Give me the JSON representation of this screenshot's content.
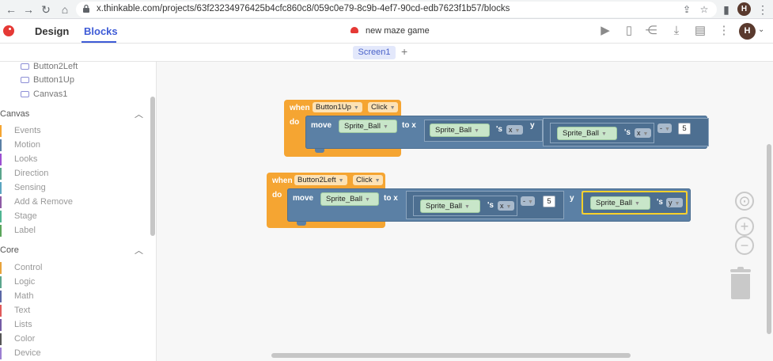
{
  "browser": {
    "url": "x.thinkable.com/projects/63f23234976425b4cfc860c8/059c0e79-8c9b-4ef7-90cd-edb7623f1b57/blocks",
    "profile_initial": "H"
  },
  "app": {
    "tabs": {
      "design": "Design",
      "blocks": "Blocks"
    },
    "project_title": "new maze game",
    "user_initial": "H",
    "screen_name": "Screen1",
    "add_screen": "+"
  },
  "sidebar": {
    "components": [
      "Button2Left",
      "Button1Up",
      "Canvas1"
    ],
    "sections": [
      {
        "title": "Canvas",
        "categories": [
          {
            "label": "Events",
            "color": "#f5a532"
          },
          {
            "label": "Motion",
            "color": "#5b80a5"
          },
          {
            "label": "Looks",
            "color": "#9c4fd1"
          },
          {
            "label": "Direction",
            "color": "#5ba58c"
          },
          {
            "label": "Sensing",
            "color": "#5ba5c0"
          },
          {
            "label": "Add & Remove",
            "color": "#8e5ba5"
          },
          {
            "label": "Stage",
            "color": "#4fb592"
          },
          {
            "label": "Label",
            "color": "#5ba55b"
          }
        ]
      },
      {
        "title": "Core",
        "categories": [
          {
            "label": "Control",
            "color": "#e8a33b"
          },
          {
            "label": "Logic",
            "color": "#5ba58c"
          },
          {
            "label": "Math",
            "color": "#5b67a5"
          },
          {
            "label": "Text",
            "color": "#e05a5a"
          },
          {
            "label": "Lists",
            "color": "#745ba5"
          },
          {
            "label": "Color",
            "color": "#555555"
          },
          {
            "label": "Device",
            "color": "#9c7fd1"
          }
        ]
      }
    ]
  },
  "blocks": {
    "event1": {
      "when": "when",
      "component": "Button1Up",
      "event": "Click",
      "do": "do",
      "move": "move",
      "sprite": "Sprite_Ball",
      "to_x": "to x",
      "x_sprite": "Sprite_Ball",
      "x_prop_s": "'s",
      "x_prop": "x",
      "y": "y",
      "y_sprite": "Sprite_Ball",
      "y_prop_s": "'s",
      "y_prop": "x",
      "y_op": "-",
      "y_num": "5"
    },
    "event2": {
      "when": "when",
      "component": "Button2Left",
      "event": "Click",
      "do": "do",
      "move": "move",
      "sprite": "Sprite_Ball",
      "to_x": "to x",
      "x_sprite": "Sprite_Ball",
      "x_prop_s": "'s",
      "x_prop": "x",
      "x_op": "-",
      "x_num": "5",
      "y": "y",
      "y_sprite": "Sprite_Ball",
      "y_prop_s": "'s",
      "y_prop": "y"
    }
  },
  "canvas_controls": {
    "recenter": "⊙",
    "zoom_in": "+",
    "zoom_out": "−"
  }
}
